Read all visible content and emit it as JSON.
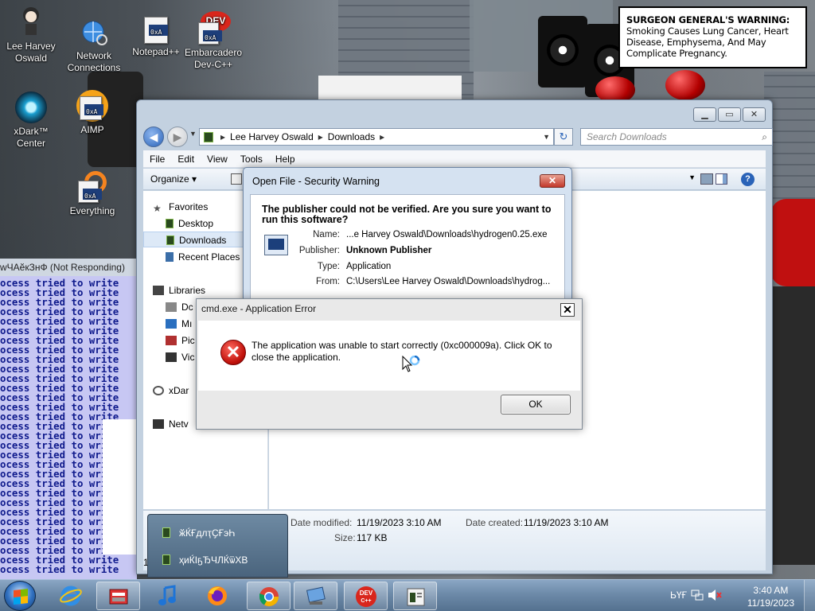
{
  "desktop": {
    "icons": [
      {
        "label": "Lee Harvey Oswald"
      },
      {
        "label": "Network Connections"
      },
      {
        "label": "Notepad++"
      },
      {
        "label": "Embarcadero Dev-C++"
      },
      {
        "label": "xDark™ Center"
      },
      {
        "label": "AIMP"
      },
      {
        "label": "Everything"
      }
    ],
    "warning": {
      "head": "SURGEON GENERAL'S WARNING:",
      "text": "Smoking Causes Lung Cancer, Heart Disease, Emphysema, And May Complicate Pregnancy."
    }
  },
  "cmd_window": {
    "title": "wЧАӗкЗнФ (Not Responding)",
    "line": "ocess tried to write"
  },
  "explorer": {
    "breadcrumb": [
      "Lee Harvey Oswald",
      "Downloads"
    ],
    "search_placeholder": "Search Downloads",
    "menu": [
      "File",
      "Edit",
      "View",
      "Tools",
      "Help"
    ],
    "organize": "Organize",
    "nav": {
      "favorites": "Favorites",
      "desktop": "Desktop",
      "downloads": "Downloads",
      "recent": "Recent Places",
      "libraries": "Libraries",
      "lib_items": [
        "Dc",
        "Mı",
        "Pic",
        "Vic"
      ],
      "homegroup": "xDar",
      "network": "Netv"
    },
    "details": {
      "modified_label": "Date modified:",
      "modified": "11/19/2023 3:10 AM",
      "created_label": "Date created:",
      "created": "11/19/2023 3:10 AM",
      "size_label": "Size:",
      "size": "117 KB",
      "count": "1"
    }
  },
  "security_warning": {
    "title": "Open File - Security Warning",
    "question": "The publisher could not be verified.  Are you sure you want to run this software?",
    "fields": [
      {
        "k": "Name:",
        "v": "...e Harvey Oswald\\Downloads\\hydrogen0.25.exe"
      },
      {
        "k": "Publisher:",
        "v": "Unknown Publisher"
      },
      {
        "k": "Type:",
        "v": "Application"
      },
      {
        "k": "From:",
        "v": "C:\\Users\\Lee Harvey Oswald\\Downloads\\hydrog..."
      }
    ]
  },
  "error_dialog": {
    "title": "cmd.exe - Application Error",
    "message": "The application was unable to start correctly (0xc000009a). Click OK to close the application.",
    "ok": "OK"
  },
  "taskbar_popup": {
    "items": [
      "ӂЌҒдлҭҪҒэҺ",
      "ҳиЌІҕЂЧЛЌѿХВ"
    ]
  },
  "taskbar": {
    "lang": "ЬҮҒ",
    "time": "3:40 AM",
    "date": "11/19/2023"
  }
}
